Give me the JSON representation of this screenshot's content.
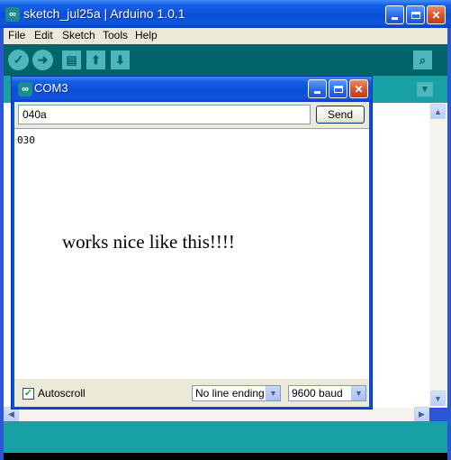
{
  "main_window": {
    "title": "sketch_jul25a | Arduino 1.0.1",
    "icon_glyph": "∞",
    "menu": [
      "File",
      "Edit",
      "Sketch",
      "Tools",
      "Help"
    ],
    "toolbar_icons": [
      "verify-icon",
      "upload-icon",
      "new-icon",
      "open-icon",
      "save-icon",
      "serial-monitor-icon"
    ],
    "colors": {
      "toolbar": "#006468",
      "tabs": "#17a1a5",
      "xp_title": "#0a4fd8"
    }
  },
  "serial_monitor": {
    "title": "COM3",
    "icon_glyph": "∞",
    "send_input_value": "040a",
    "send_label": "Send",
    "output_text": "030",
    "annotation": "works nice like this!!!!",
    "autoscroll_label": "Autoscroll",
    "autoscroll_checked": true,
    "line_ending_value": "No line ending",
    "baud_value": "9600 baud"
  }
}
